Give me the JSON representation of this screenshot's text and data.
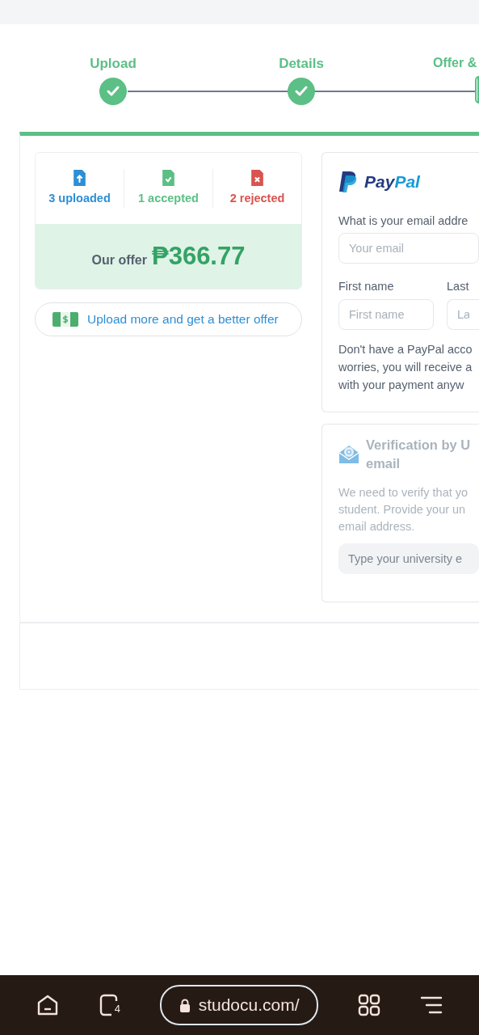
{
  "steps": [
    {
      "label": "Upload",
      "done": true
    },
    {
      "label": "Details",
      "done": true
    },
    {
      "label": "Offer &",
      "done": false
    }
  ],
  "stats": [
    {
      "kind": "uploaded",
      "text": "3 uploaded",
      "color": "#2d8fd5"
    },
    {
      "kind": "accepted",
      "text": "1 accepted",
      "color": "#5cbf86"
    },
    {
      "kind": "rejected",
      "text": "2 rejected",
      "color": "#d9534f"
    }
  ],
  "offer": {
    "label": "Our offer",
    "amount": "₱366.77"
  },
  "upload_more_button": "Upload more and get a better offer",
  "paypal": {
    "logo": "PayPal",
    "email_label": "What is your email addre",
    "email_placeholder": "Your email",
    "first_name_label": "First name",
    "first_name_placeholder": "First name",
    "last_name_label": "Last",
    "last_name_placeholder": "La",
    "note": "Don't have a PayPal acco\nworries, you will receive a\nwith your payment anyw"
  },
  "verification": {
    "title": "Verification by U\nemail",
    "text": "We need to verify that yo\nstudent. Provide your un\nemail address.",
    "placeholder": "Type your university e",
    "disabled": true
  },
  "browser_bar": {
    "tab_count": "4",
    "url": "studocu.com/"
  }
}
